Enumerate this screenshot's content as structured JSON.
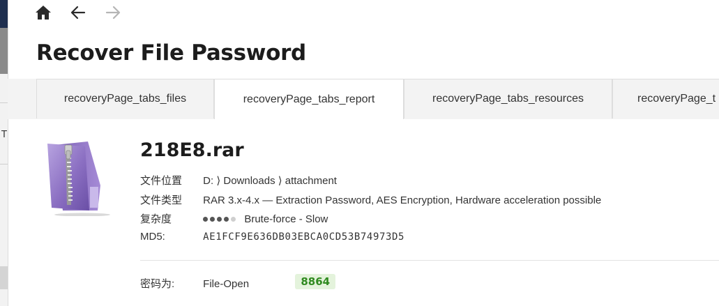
{
  "page": {
    "title": "Recover File Password"
  },
  "nav": {
    "home_icon": "home-icon",
    "back_icon": "arrow-left-icon",
    "forward_icon": "arrow-right-icon"
  },
  "tabs": [
    {
      "label": "recoveryPage_tabs_files",
      "active": false
    },
    {
      "label": "recoveryPage_tabs_report",
      "active": true
    },
    {
      "label": "recoveryPage_tabs_resources",
      "active": false
    },
    {
      "label": "recoveryPage_t",
      "active": false
    }
  ],
  "file": {
    "name": "218E8.rar",
    "icon": "rar-archive-icon",
    "location_label": "文件位置",
    "location_value": "D: ⟩ Downloads ⟩ attachment",
    "type_label": "文件类型",
    "type_value": "RAR 3.x-4.x — Extraction Password, AES Encryption, Hardware acceleration possible",
    "complexity_label": "复杂度",
    "complexity_level": 4,
    "complexity_max": 5,
    "complexity_value": "Brute-force - Slow",
    "md5_label": "MD5:",
    "md5_value": "AE1FCF9E636DB03EBCA0CD53B74973D5"
  },
  "result": {
    "label": "密码为:",
    "mode": "File-Open",
    "password": "8864"
  },
  "sidebar_glyph": "T",
  "colors": {
    "accent_green": "#2f8a1f",
    "badge_bg": "#e4f3dc",
    "icon_purple": "#8b6fc2"
  }
}
